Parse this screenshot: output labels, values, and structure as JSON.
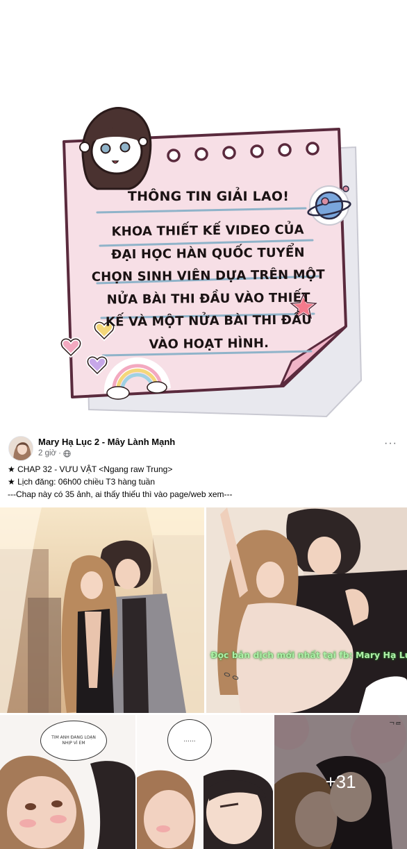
{
  "note": {
    "heading": "THÔNG TIN GIẢI LAO!",
    "lines": [
      "KHOA THIẾT KẾ VIDEO CỦA",
      "ĐẠI HỌC HÀN QUỐC TUYỂN",
      "CHỌN SINH VIÊN DỰA TRÊN MỘT",
      "NỬA BÀI THI ĐẦU VÀO THIẾT",
      "KẾ VÀ MỘT NỬA BÀI THI ĐẦU",
      "VÀO HOẠT HÌNH."
    ],
    "colors": {
      "paper": "#f7dfe6",
      "border": "#5a2a3d",
      "rule": "#8fb3c9"
    }
  },
  "post": {
    "page_name": "Mary Hạ Lục 2 - Mây Lành Mạnh",
    "time": "2 giờ",
    "dot": "·",
    "privacy_icon": "globe-icon",
    "more_label": "···",
    "line1": "★ CHAP 32 - VƯU VẬT <Ngang raw Trung>",
    "line2": "★ Lịch đăng: 06h00 chiều T3 hàng tuần",
    "line3": "---Chap này có 35 ảnh, ai thấy thiếu thì vào page/web xem---"
  },
  "photos": {
    "watermark": "Đọc bản dịch mới nhất tại fb: Mary Hạ Lục",
    "sfx_1": "ᄋᄋ",
    "bubble_1": "TIM ANH ĐANG LOẠN NHỊP VÌ EM",
    "bubble_2": "......",
    "sfx_2": "ᄀᄅ",
    "more_count": "+31"
  }
}
